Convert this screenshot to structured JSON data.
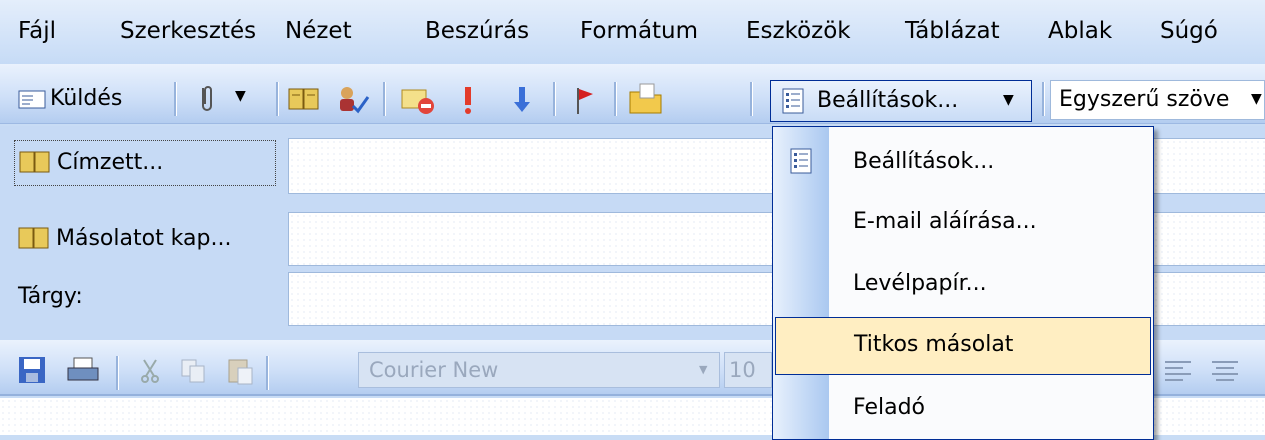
{
  "menubar": {
    "items": [
      {
        "label": "Fájl"
      },
      {
        "label": "Szerkesztés"
      },
      {
        "label": "Nézet"
      },
      {
        "label": "Beszúrás"
      },
      {
        "label": "Formátum"
      },
      {
        "label": "Eszközök"
      },
      {
        "label": "Táblázat"
      },
      {
        "label": "Ablak"
      },
      {
        "label": "Súgó"
      }
    ]
  },
  "toolbar": {
    "send_label": "Küldés",
    "options_label": "Beállítások...",
    "format_select": "Egyszerű szöve"
  },
  "header": {
    "to_label": "Címzett...",
    "cc_label": "Másolatot kap...",
    "subject_label": "Tárgy:"
  },
  "format": {
    "font_value": "Courier New",
    "size_value": "10"
  },
  "dropdown": {
    "items": [
      {
        "label": "Beállítások..."
      },
      {
        "label": "E-mail aláírása..."
      },
      {
        "label": "Levélpapír..."
      },
      {
        "label": "Titkos másolat"
      },
      {
        "label": "Feladó"
      }
    ]
  },
  "colors": {
    "highlight": "#ffeec2",
    "menu_border": "#002d96",
    "bar_blue": "#c6daf5"
  }
}
